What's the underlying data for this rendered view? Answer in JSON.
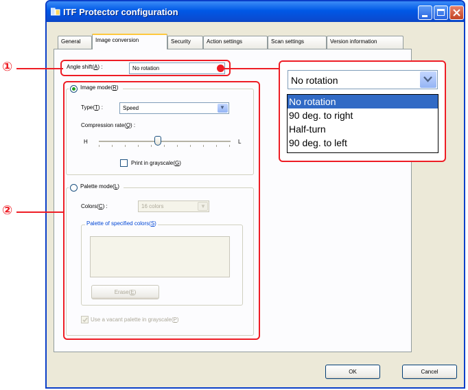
{
  "window": {
    "title": "ITF Protector configuration"
  },
  "tabs": [
    {
      "label": "General"
    },
    {
      "label": "Image conversion"
    },
    {
      "label": "Security"
    },
    {
      "label": "Action settings"
    },
    {
      "label": "Scan settings"
    },
    {
      "label": "Version information"
    }
  ],
  "angle": {
    "label_pre": "Angle shift(",
    "key": "A",
    "label_post": ") :",
    "value": "No rotation"
  },
  "image_mode": {
    "label_pre": "Image mode(",
    "key": "R",
    "label_post": ")",
    "type_pre": "Type(",
    "type_key": "T",
    "type_post": ") :",
    "type_value": "Speed",
    "comp_pre": "Compression rate(",
    "comp_key": "Q",
    "comp_post": ") :",
    "slider_left": "H",
    "slider_right": "L",
    "compression_level": 0.45,
    "gray_pre": "Print in grayscale(",
    "gray_key": "G",
    "gray_post": ")"
  },
  "palette_mode": {
    "label_pre": "Palette mode(",
    "key": "L",
    "label_post": ")",
    "colors_pre": "Colors(",
    "colors_key": "C",
    "colors_post": ") :",
    "colors_value": "16 colors",
    "specified_pre": "Palette of specified colors(",
    "specified_key": "S",
    "specified_post": ")",
    "erase_pre": "Erase(",
    "erase_key": "E",
    "erase_post": ")",
    "vacant_pre": "Use a vacant palette in grayscale(",
    "vacant_key": "P",
    "vacant_post": ")"
  },
  "buttons": {
    "ok": "OK",
    "cancel": "Cancel"
  },
  "annotations": {
    "marker1": "①",
    "marker2": "②"
  },
  "dropdown": {
    "selected": "No rotation",
    "options": [
      "No rotation",
      "90 deg. to right",
      "Half-turn",
      "90 deg. to left"
    ]
  },
  "colors": {
    "annotation": "#ee1c24",
    "title_bar": "#0058e6",
    "selection": "#316ac5"
  }
}
